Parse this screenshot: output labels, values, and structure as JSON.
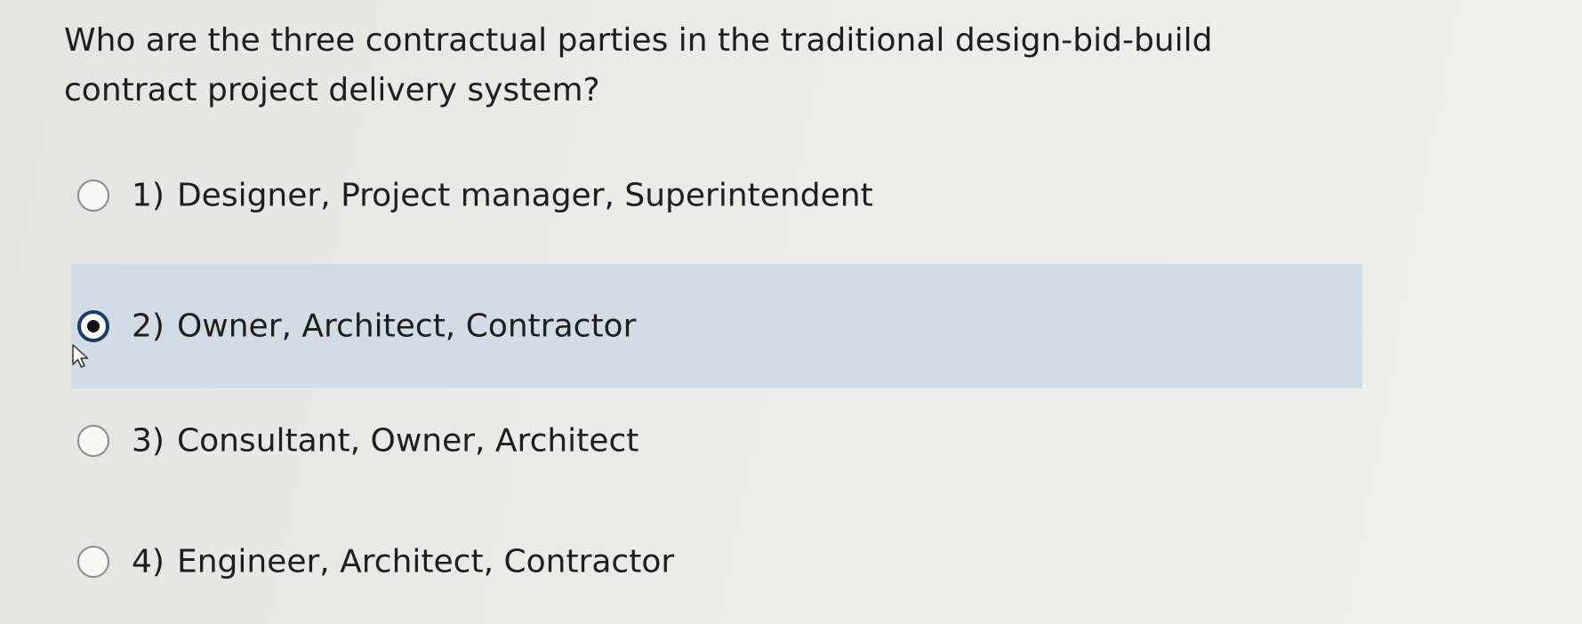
{
  "question": {
    "text": "Who are the three contractual parties in the traditional design-bid-build contract project delivery system?"
  },
  "options": [
    {
      "number": "1)",
      "label": "Designer, Project manager, Superintendent",
      "selected": false
    },
    {
      "number": "2)",
      "label": "Owner, Architect, Contractor",
      "selected": true
    },
    {
      "number": "3)",
      "label": "Consultant, Owner, Architect",
      "selected": false
    },
    {
      "number": "4)",
      "label": "Engineer, Architect, Contractor",
      "selected": false
    }
  ],
  "colors": {
    "selected_background": "#d1dce7",
    "selected_radio_ring": "#1d3a68",
    "text": "#1e1e1e"
  },
  "icons": {
    "cursor": "mouse-pointer-icon"
  }
}
